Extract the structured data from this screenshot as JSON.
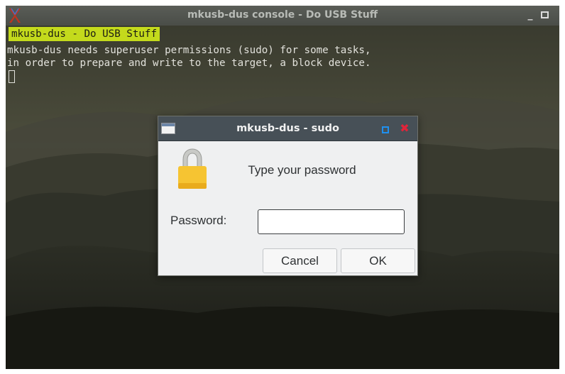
{
  "console": {
    "title": "mkusb-dus console - Do USB Stuff",
    "minimize_glyph": "_",
    "heading": "mkusb-dus - Do USB Stuff",
    "lines": [
      "mkusb-dus needs superuser permissions (sudo) for some tasks,",
      "in order to prepare and write to the target, a block device."
    ]
  },
  "dialog": {
    "title": "mkusb-dus - sudo",
    "close_glyph": "✖",
    "prompt": "Type your password",
    "password_label": "Password:",
    "password_value": "",
    "cancel_label": "Cancel",
    "ok_label": "OK"
  },
  "icons": {
    "app": "mkusb-x-icon",
    "lock": "padlock-icon",
    "dialog_window": "window-icon"
  },
  "colors": {
    "heading_highlight": "#c4da1c",
    "dialog_titlebar": "#475057",
    "dialog_maximize": "#1f90f0",
    "dialog_close": "#e0243a"
  }
}
